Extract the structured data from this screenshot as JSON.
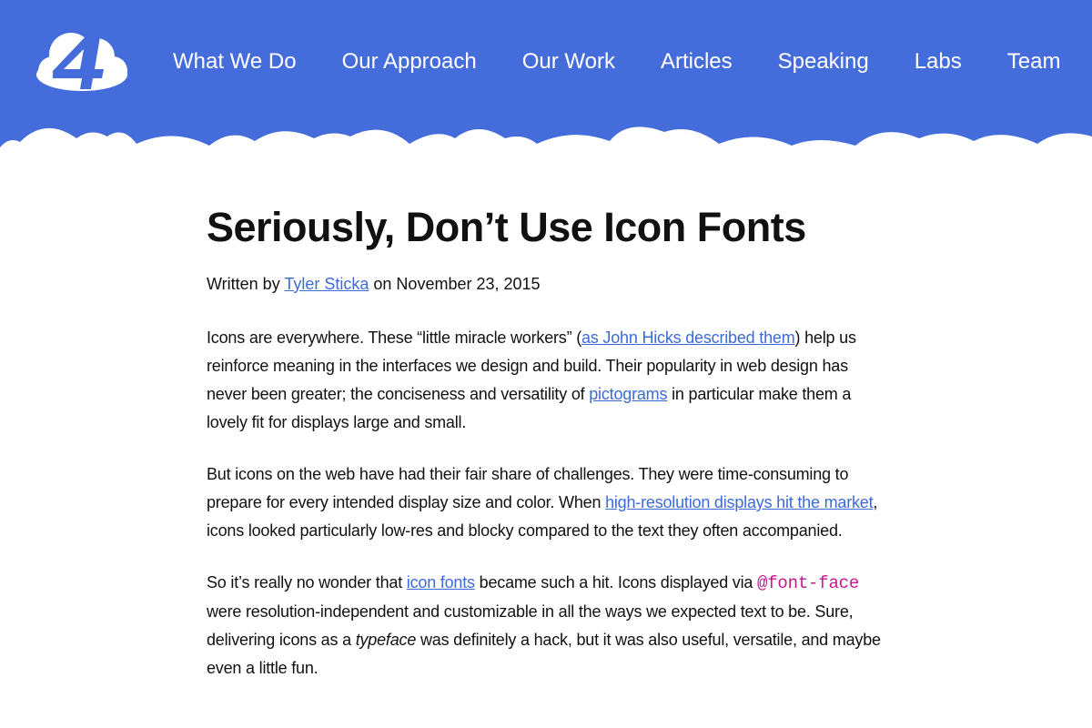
{
  "colors": {
    "header_background": "#456cdb",
    "link": "#3d6bd6",
    "code": "#c7178c",
    "text": "#111111"
  },
  "header": {
    "logo_icon": "cloud-four-logo",
    "nav": [
      {
        "label": "What We Do"
      },
      {
        "label": "Our Approach"
      },
      {
        "label": "Our Work"
      },
      {
        "label": "Articles"
      },
      {
        "label": "Speaking"
      },
      {
        "label": "Labs"
      },
      {
        "label": "Team"
      }
    ]
  },
  "article": {
    "title": "Seriously, Don’t Use Icon Fonts",
    "byline": {
      "prefix": "Written by ",
      "author": "Tyler Sticka",
      "suffix": " on November 23, 2015"
    },
    "paragraphs": [
      {
        "t1": "Icons are everywhere. These “little miracle workers” (",
        "link1": "as John Hicks described them",
        "t2": ") help us reinforce meaning in the interfaces we design and build. Their popularity in web design has never been greater; the conciseness and versatility of ",
        "link2": "pictograms",
        "t3": " in particular make them a lovely fit for displays large and small."
      },
      {
        "t1": "But icons on the web have had their fair share of challenges. They were time-consuming to prepare for every intended display size and color. When ",
        "link1": "high-resolution displays hit the market",
        "t2": ", icons looked particularly low-res and blocky compared to the text they often accompanied."
      },
      {
        "t1": "So it’s really no wonder that ",
        "link1": "icon fonts",
        "t2": " became such a hit. Icons displayed via ",
        "code": "@font-face",
        "t3": " were resolution-independent and customizable in all the ways we expected text to be. Sure, delivering icons as a ",
        "em": "typeface",
        "t4": " was definitely a hack, but it was also useful, versatile, and maybe even a little fun."
      }
    ]
  }
}
